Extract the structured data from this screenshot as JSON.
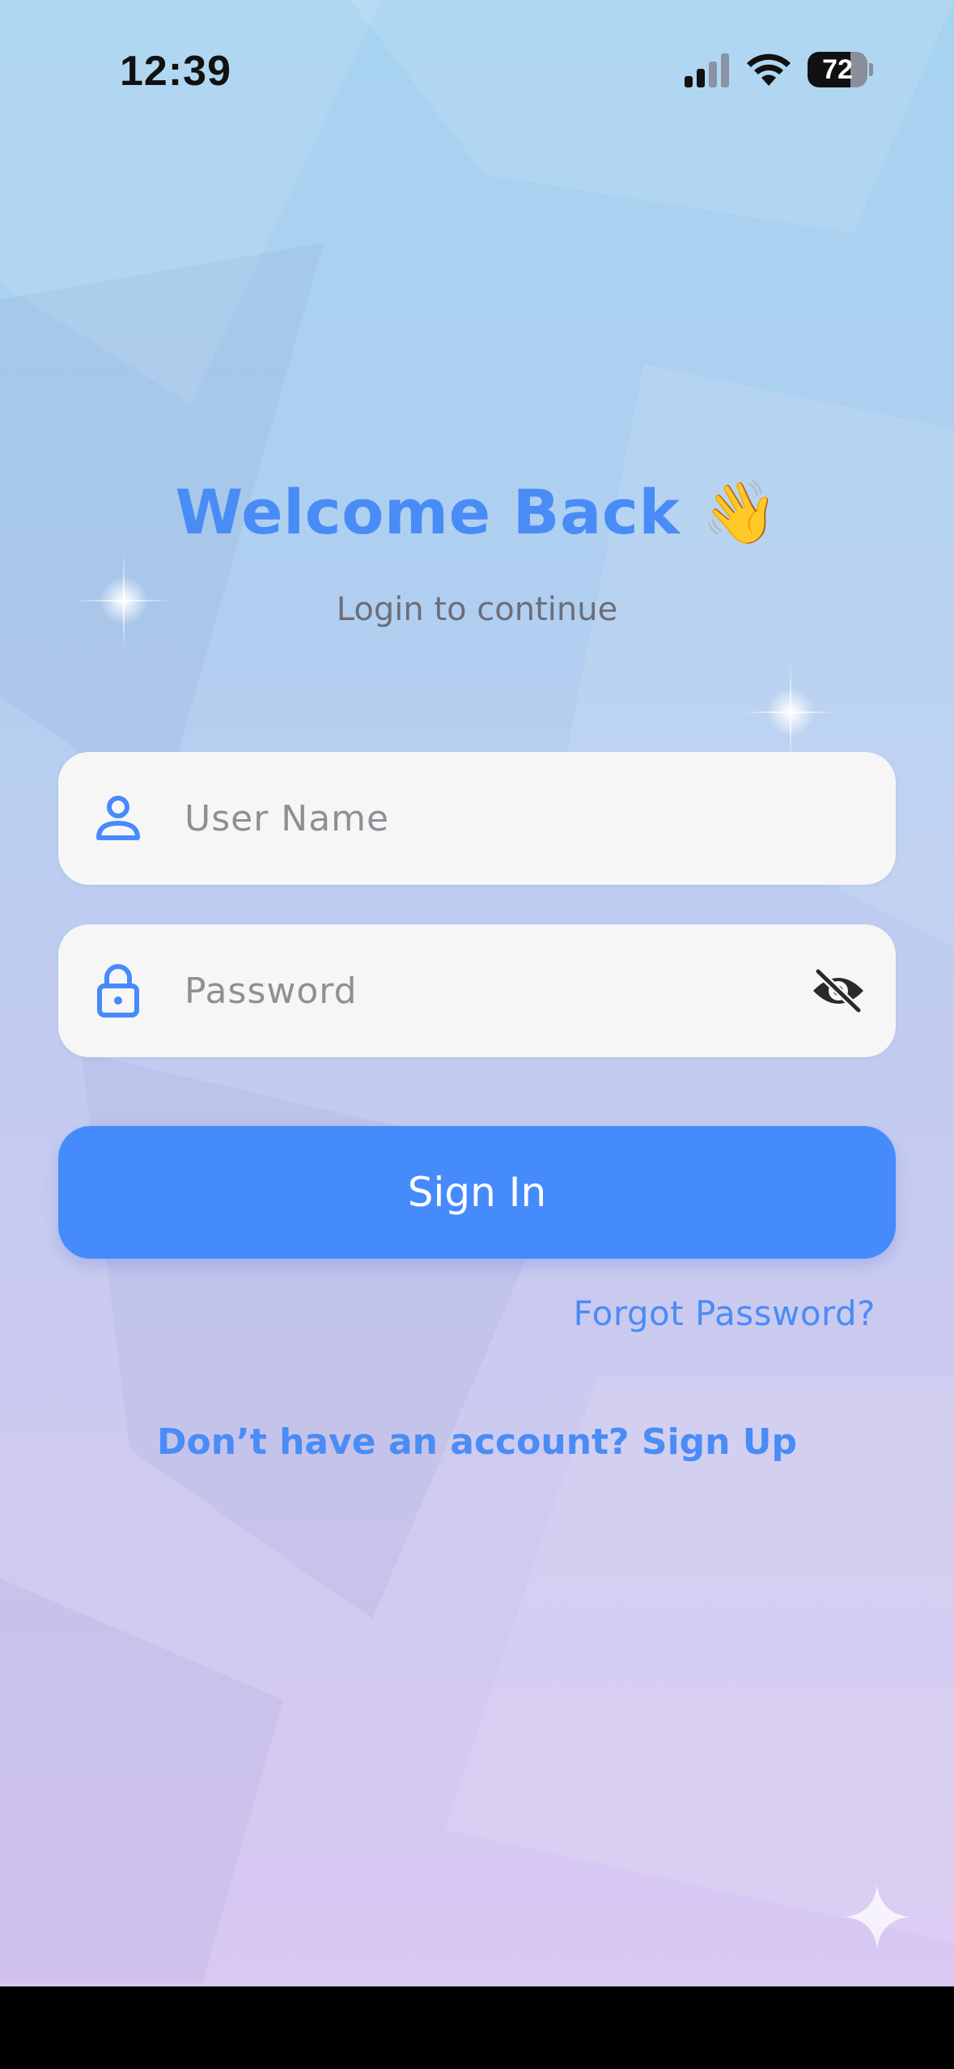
{
  "status_bar": {
    "time": "12:39",
    "battery_percent": "72",
    "battery_level": 0.72,
    "icons": [
      "signal-icon",
      "wifi-icon",
      "battery-icon"
    ]
  },
  "login": {
    "title": "Welcome Back 👋",
    "subtitle": "Login to continue",
    "username_placeholder": "User Name",
    "password_placeholder": "Password",
    "sign_in_label": "Sign In",
    "forgot_password_label": "Forgot Password?",
    "signup_label": "Don’t have an account? Sign Up"
  },
  "icons": {
    "username_field": "person-icon",
    "password_field": "lock-icon",
    "password_toggle": "eye-slash-icon",
    "corner_mark": "sparkle-star-icon"
  },
  "colors": {
    "accent": "#468bfc",
    "title_text": "#4a8cf6",
    "subtitle_text": "#6d6d78",
    "field_background": "#f6f6f6",
    "background_top": "#a6d3f0",
    "background_bottom": "#d8c8f2"
  }
}
